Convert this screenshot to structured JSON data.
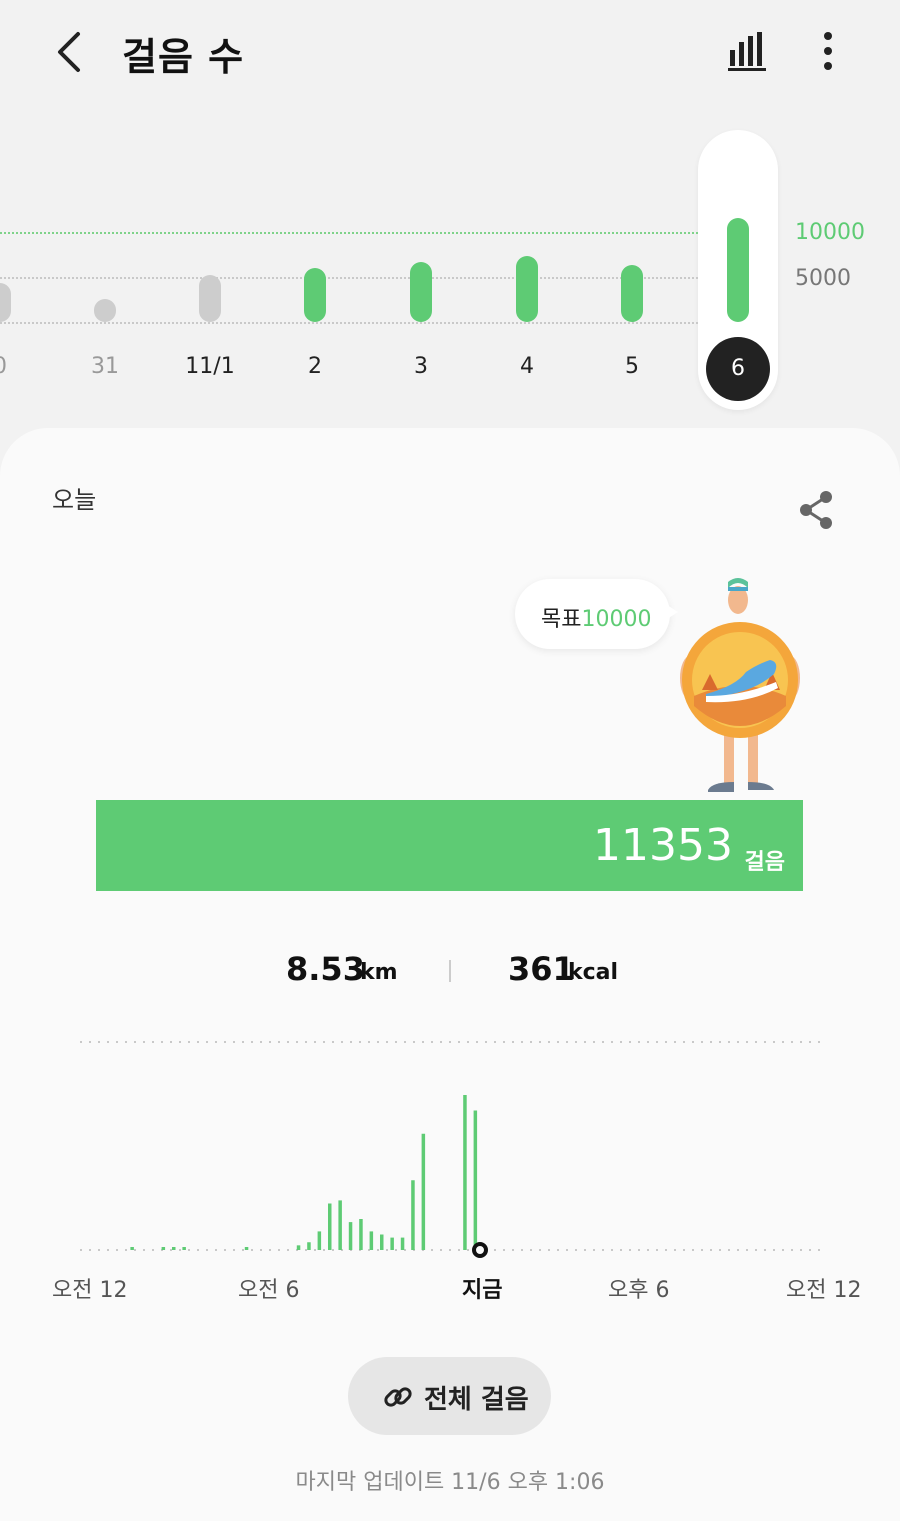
{
  "header": {
    "title": "걸음 수"
  },
  "weekly_chart": {
    "goal_line_label": "10000",
    "mid_line_label": "5000",
    "goal_color": "#5ecb74",
    "days": [
      {
        "label": "0",
        "steps": 3500
      },
      {
        "label": "31",
        "steps": 300
      },
      {
        "label": "11/1",
        "steps": 5000
      },
      {
        "label": "2",
        "steps": 6400
      },
      {
        "label": "3",
        "steps": 7600
      },
      {
        "label": "4",
        "steps": 8800
      },
      {
        "label": "5",
        "steps": 7000
      },
      {
        "label": "6",
        "steps": 11353,
        "selected": true
      }
    ]
  },
  "today": {
    "label": "오늘",
    "goal_prefix": "목표",
    "goal_value": "10000",
    "steps_value": "11353",
    "steps_unit": "걸음",
    "distance_value": "8.53",
    "distance_unit": "km",
    "calories_value": "361",
    "calories_unit": "kcal"
  },
  "hourly_chart": {
    "x_labels": [
      "오전 12",
      "오전 6",
      "지금",
      "오후 6",
      "오전 12"
    ],
    "values": [
      0,
      1,
      0,
      0,
      1,
      1,
      1,
      0,
      0,
      0,
      0,
      0,
      1,
      0,
      0,
      0,
      0,
      3,
      5,
      12,
      30,
      32,
      18,
      20,
      12,
      10,
      8,
      8,
      45,
      75,
      0,
      0,
      0,
      100,
      90,
      0,
      0
    ]
  },
  "all_steps_button": {
    "label": "전체 걸음"
  },
  "last_update": "마지막 업데이트 11/6 오후 1:06"
}
